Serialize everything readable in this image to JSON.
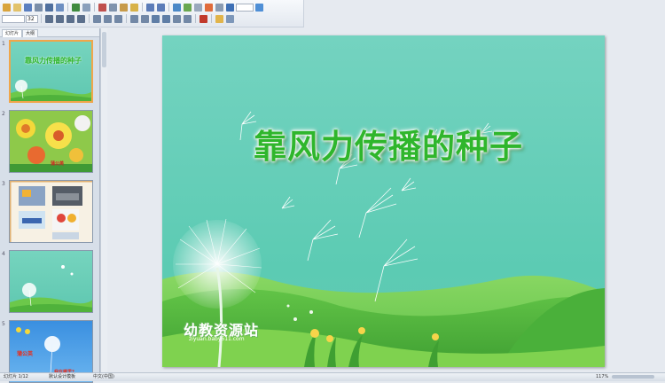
{
  "toolbar": {
    "font_size": "32"
  },
  "left_panel": {
    "tabs": [
      {
        "label": "幻灯片"
      },
      {
        "label": "大纲"
      }
    ],
    "thumbnails": [
      {
        "number": "1",
        "title": "靠风力传播的种子"
      },
      {
        "number": "2",
        "label": "蒲公英"
      },
      {
        "number": "3"
      },
      {
        "number": "4"
      },
      {
        "number": "5",
        "label1": "蒲公英",
        "label2": "我在哪里?"
      }
    ]
  },
  "slide": {
    "title": "靠风力传播的种子",
    "watermark": "幼教资源站",
    "watermark_url": "ziyuan.baby611.com"
  },
  "status_bar": {
    "slide_info": "幻灯片 1/12",
    "theme": "默认设计模板",
    "language": "中文(中国)",
    "zoom": "117%"
  },
  "colors": {
    "title_green": "#2fb62c",
    "sky_top": "#6fd0b9",
    "sky_bottom": "#5ec8b2",
    "grass": "#7bd04c",
    "selection": "#f0a64a"
  }
}
